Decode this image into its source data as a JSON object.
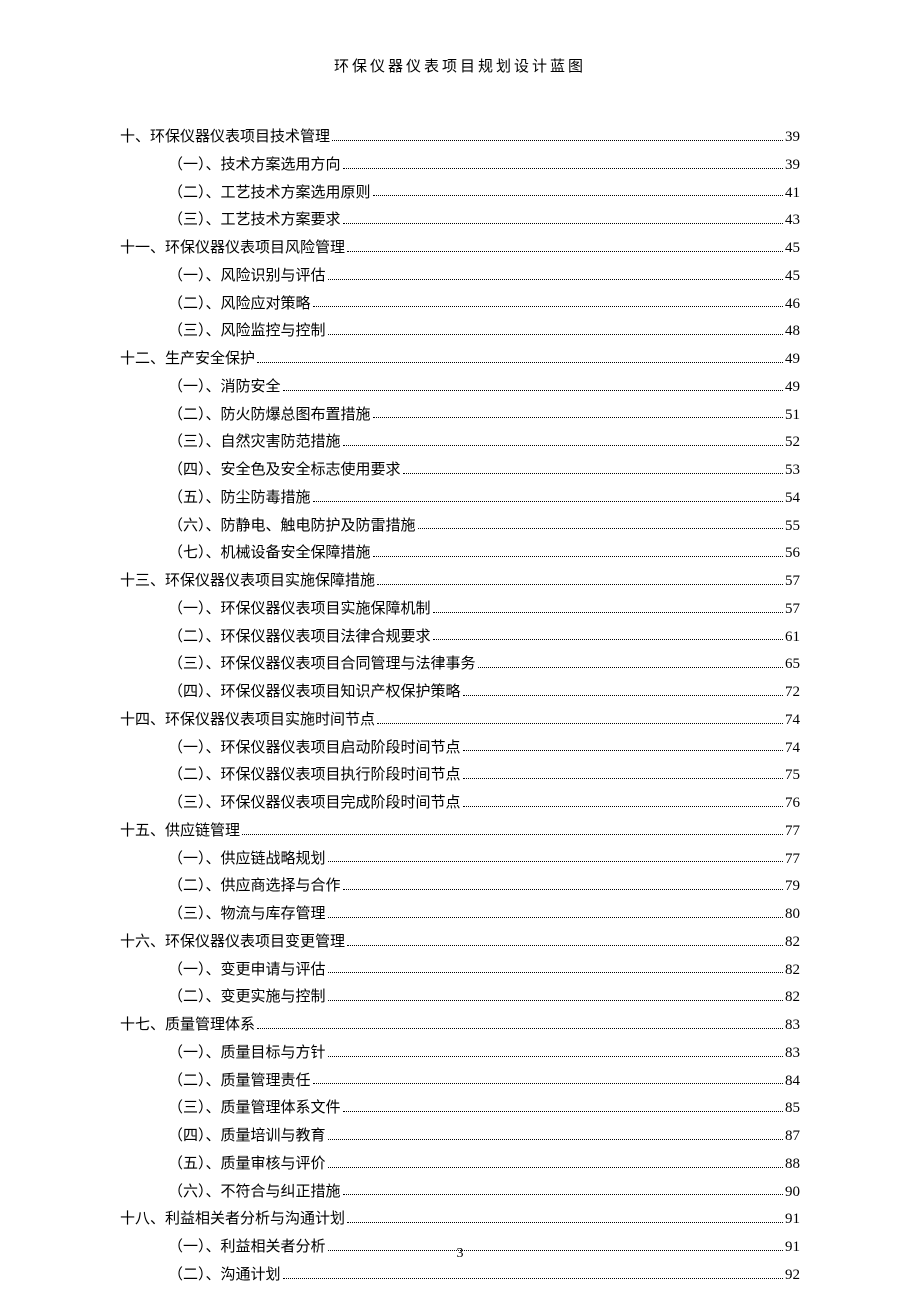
{
  "header_title": "环保仪器仪表项目规划设计蓝图",
  "page_number": "3",
  "toc": [
    {
      "level": 1,
      "label": "十、环保仪器仪表项目技术管理",
      "page": "39"
    },
    {
      "level": 2,
      "label": "（一）、技术方案选用方向",
      "page": "39"
    },
    {
      "level": 2,
      "label": "（二）、工艺技术方案选用原则",
      "page": "41"
    },
    {
      "level": 2,
      "label": "（三）、工艺技术方案要求",
      "page": "43"
    },
    {
      "level": 1,
      "label": "十一、环保仪器仪表项目风险管理",
      "page": "45"
    },
    {
      "level": 2,
      "label": "（一）、风险识别与评估",
      "page": "45"
    },
    {
      "level": 2,
      "label": "（二）、风险应对策略",
      "page": "46"
    },
    {
      "level": 2,
      "label": "（三）、风险监控与控制",
      "page": "48"
    },
    {
      "level": 1,
      "label": "十二、生产安全保护",
      "page": "49"
    },
    {
      "level": 2,
      "label": "（一）、消防安全",
      "page": "49"
    },
    {
      "level": 2,
      "label": "（二）、防火防爆总图布置措施",
      "page": "51"
    },
    {
      "level": 2,
      "label": "（三）、自然灾害防范措施",
      "page": "52"
    },
    {
      "level": 2,
      "label": "（四）、安全色及安全标志使用要求",
      "page": "53"
    },
    {
      "level": 2,
      "label": "（五）、防尘防毒措施",
      "page": "54"
    },
    {
      "level": 2,
      "label": "（六）、防静电、触电防护及防雷措施",
      "page": "55"
    },
    {
      "level": 2,
      "label": "（七）、机械设备安全保障措施",
      "page": "56"
    },
    {
      "level": 1,
      "label": "十三、环保仪器仪表项目实施保障措施",
      "page": "57"
    },
    {
      "level": 2,
      "label": "（一）、环保仪器仪表项目实施保障机制",
      "page": "57"
    },
    {
      "level": 2,
      "label": "（二）、环保仪器仪表项目法律合规要求",
      "page": "61"
    },
    {
      "level": 2,
      "label": "（三）、环保仪器仪表项目合同管理与法律事务",
      "page": "65"
    },
    {
      "level": 2,
      "label": "（四）、环保仪器仪表项目知识产权保护策略",
      "page": "72"
    },
    {
      "level": 1,
      "label": "十四、环保仪器仪表项目实施时间节点",
      "page": "74"
    },
    {
      "level": 2,
      "label": "（一）、环保仪器仪表项目启动阶段时间节点",
      "page": "74"
    },
    {
      "level": 2,
      "label": "（二）、环保仪器仪表项目执行阶段时间节点",
      "page": "75"
    },
    {
      "level": 2,
      "label": "（三）、环保仪器仪表项目完成阶段时间节点",
      "page": "76"
    },
    {
      "level": 1,
      "label": "十五、供应链管理",
      "page": "77"
    },
    {
      "level": 2,
      "label": "（一）、供应链战略规划",
      "page": "77"
    },
    {
      "level": 2,
      "label": "（二）、供应商选择与合作",
      "page": "79"
    },
    {
      "level": 2,
      "label": "（三）、物流与库存管理",
      "page": "80"
    },
    {
      "level": 1,
      "label": "十六、环保仪器仪表项目变更管理",
      "page": "82"
    },
    {
      "level": 2,
      "label": "（一）、变更申请与评估",
      "page": "82"
    },
    {
      "level": 2,
      "label": "（二）、变更实施与控制",
      "page": "82"
    },
    {
      "level": 1,
      "label": "十七、质量管理体系",
      "page": "83"
    },
    {
      "level": 2,
      "label": "（一）、质量目标与方针",
      "page": "83"
    },
    {
      "level": 2,
      "label": "（二）、质量管理责任",
      "page": "84"
    },
    {
      "level": 2,
      "label": "（三）、质量管理体系文件",
      "page": "85"
    },
    {
      "level": 2,
      "label": "（四）、质量培训与教育",
      "page": "87"
    },
    {
      "level": 2,
      "label": "（五）、质量审核与评价",
      "page": "88"
    },
    {
      "level": 2,
      "label": "（六）、不符合与纠正措施",
      "page": "90"
    },
    {
      "level": 1,
      "label": "十八、利益相关者分析与沟通计划",
      "page": "91"
    },
    {
      "level": 2,
      "label": "（一）、利益相关者分析",
      "page": "91"
    },
    {
      "level": 2,
      "label": "（二）、沟通计划",
      "page": "92"
    }
  ]
}
